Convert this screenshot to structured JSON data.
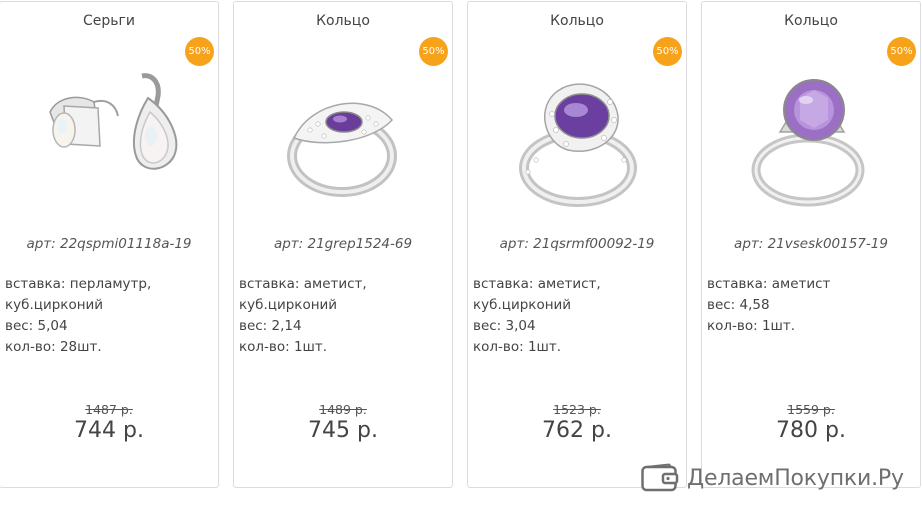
{
  "badge_color": "#f7a21b",
  "products": [
    {
      "category": "Серьги",
      "discount": "50%",
      "image": "earrings-pearl",
      "sku": "арт: 22qspmi01118a-19",
      "specs": [
        "вставка: перламутр,",
        "куб.цирконий",
        "вес: 5,04",
        "кол-во: 28шт."
      ],
      "old_price": "1487 р.",
      "price": "744 р."
    },
    {
      "category": "Кольцо",
      "discount": "50%",
      "image": "ring-amethyst-oval",
      "sku": "арт: 21grep1524-69",
      "specs": [
        "вставка: аметист,",
        "куб.цирконий",
        "вес: 2,14",
        "кол-во: 1шт."
      ],
      "old_price": "1489 р.",
      "price": "745 р."
    },
    {
      "category": "Кольцо",
      "discount": "50%",
      "image": "ring-amethyst-halo",
      "sku": "арт: 21qsrmf00092-19",
      "specs": [
        "вставка: аметист,",
        "куб.цирконий",
        "вес: 3,04",
        "кол-во: 1шт."
      ],
      "old_price": "1523 р.",
      "price": "762 р."
    },
    {
      "category": "Кольцо",
      "discount": "50%",
      "image": "ring-amethyst-round",
      "sku": "арт: 21vsesk00157-19",
      "specs": [
        "вставка: аметист",
        "вес: 4,58",
        "кол-во: 1шт."
      ],
      "old_price": "1559 р.",
      "price": "780 р."
    }
  ],
  "watermark": {
    "text": "ДелаемПокупки.Ру",
    "icon": "wallet-icon"
  }
}
